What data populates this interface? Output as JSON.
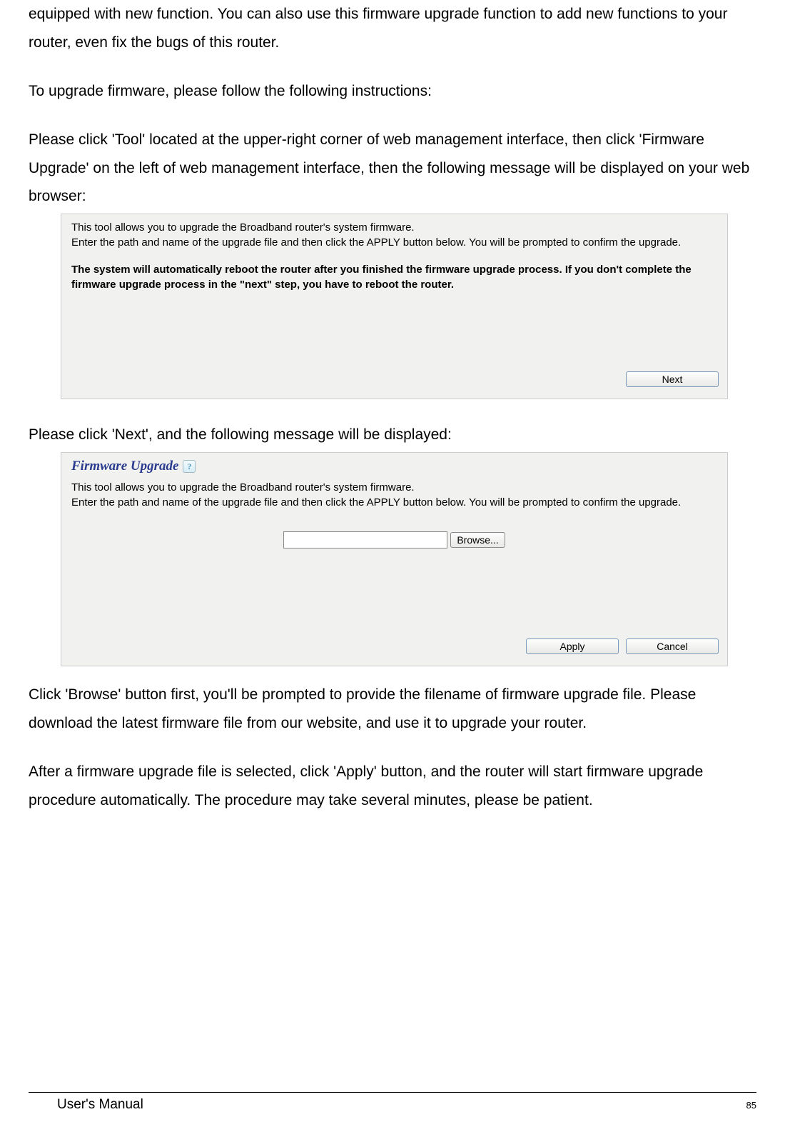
{
  "body": {
    "para1": "equipped with new function. You can also use this firmware upgrade function to add new functions to your router, even fix the bugs of this router.",
    "para2": "To upgrade firmware, please follow the following instructions:",
    "para3": "Please click 'Tool' located at the upper-right corner of web management interface, then click 'Firmware Upgrade' on the left of web management interface, then the following message will be displayed on your web browser:",
    "para4": "Please click 'Next', and the following message will be displayed:",
    "para5": "Click 'Browse' button first, you'll be prompted to provide the filename of firmware upgrade file. Please download the latest firmware file from our website, and use it to upgrade your router.",
    "para6": "After a firmware upgrade file is selected, click 'Apply' button, and the router will start firmware upgrade procedure automatically. The procedure may take several minutes, please be patient."
  },
  "panel1": {
    "line1": "This tool allows you to upgrade the Broadband router's system firmware.",
    "line2": "Enter the path and name of the upgrade file and then click the APPLY button below. You will be prompted to confirm the upgrade.",
    "bold": "The system will automatically reboot the router after you finished the firmware upgrade process. If you don't complete the firmware upgrade process in the \"next\" step, you have to reboot the router.",
    "next_label": "Next"
  },
  "panel2": {
    "heading": "Firmware Upgrade",
    "line1": "This tool allows you to upgrade the Broadband router's system firmware.",
    "line2": "Enter the path and name of the upgrade file and then click the APPLY button below. You will be prompted to confirm the upgrade.",
    "browse_label": "Browse...",
    "apply_label": "Apply",
    "cancel_label": "Cancel"
  },
  "footer": {
    "left": "User's Manual",
    "right": "85"
  }
}
